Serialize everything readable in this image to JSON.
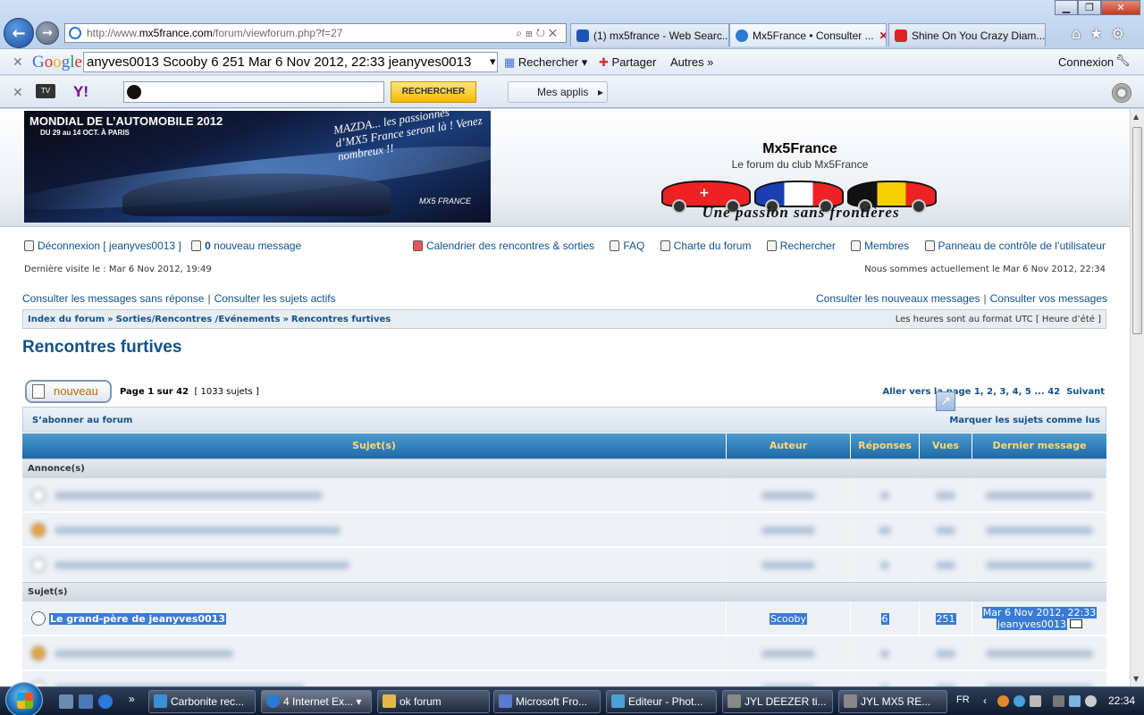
{
  "browser": {
    "address_prefix": "http://www.",
    "address_host": "mx5france.com",
    "address_path": "/forum/viewforum.php?f=27",
    "tabs": [
      {
        "label": "(1) mx5france - Web Searc...",
        "icon_color": "#1a57b5"
      },
      {
        "label": "Mx5France • Consulter ...",
        "icon_color": "#2a7ad8"
      },
      {
        "label": "Shine On You Crazy Diam...",
        "icon_color": "#d22"
      }
    ],
    "window_controls": [
      "minimize",
      "maximize",
      "close"
    ]
  },
  "google_toolbar": {
    "logo": "Google",
    "query": "anyves0013 Scooby 6 251 Mar 6 Nov 2012, 22:33 jeanyves0013",
    "search_label": "Rechercher",
    "share_label": "Partager",
    "more_label": "Autres »",
    "signin_label": "Connexion"
  },
  "yahoo_toolbar": {
    "logo": "Y!",
    "search_button": "RECHERCHER",
    "apps_label": "Mes applis"
  },
  "site": {
    "banner_title": "MONDIAL DE L’AUTOMOBILE 2012",
    "banner_date": "DU 29 au 14 OCT. À PARIS",
    "banner_slogan": "MAZDA... les passionnés d’MX5 France seront là ! Venez nombreux !!",
    "banner_logo": "MX5 FRANCE",
    "title": "Mx5France",
    "description": "Le forum du club Mx5France",
    "slogan": "Une passion sans frontières"
  },
  "nav": {
    "logout": "Déconnexion [ jeanyves0013 ]",
    "messages_count": "0",
    "messages_label": " nouveau message",
    "calendar": "Calendrier des rencontres & sorties",
    "faq": "FAQ",
    "charter": "Charte du forum",
    "search": "Rechercher",
    "members": "Membres",
    "ucp": "Panneau de contrôle de l’utilisateur",
    "last_visit": "Dernière visite le : Mar 6 Nov 2012, 19:49",
    "now": "Nous sommes actuellement le Mar 6 Nov 2012, 22:34",
    "unanswered": "Consulter les messages sans réponse",
    "active": "Consulter les sujets actifs",
    "new_posts": "Consulter les nouveaux messages",
    "your_posts": "Consulter vos messages"
  },
  "breadcrumb": {
    "items": [
      "Index du forum",
      "Sorties/Rencontres /Evénements",
      "Rencontres furtives"
    ],
    "separator": "»",
    "timezone": "Les heures sont au format UTC [ Heure d’été ]"
  },
  "forum": {
    "title": "Rencontres furtives",
    "new_topic_label": "nouveau",
    "page_prefix": "Page ",
    "page_current": "1",
    "page_of": " sur ",
    "page_total": "42",
    "topic_count": "[ 1033 sujets ]",
    "goto_label": "Aller vers la page ",
    "goto_pages": "1, 2, 3, 4, 5 ... 42",
    "next_label": "Suivant",
    "subscribe": "S’abonner au forum",
    "mark_read": "Marquer les sujets comme lus"
  },
  "table": {
    "headers": {
      "subject": "Sujet(s)",
      "author": "Auteur",
      "replies": "Réponses",
      "views": "Vues",
      "last": "Dernier message"
    },
    "announcements_label": "Annonce(s)",
    "topics_label": "Sujet(s)",
    "highlighted_topic": {
      "title": "Le grand-père de jeanyves0013",
      "author": "Scooby",
      "replies": "6",
      "views": "251",
      "last_date": "Mar 6 Nov 2012, 22:33",
      "last_author": "jeanyves0013"
    }
  },
  "taskbar": {
    "buttons": [
      {
        "label": "Carbonite rec...",
        "color": "#3a8fd8"
      },
      {
        "label": "4 Internet Ex...",
        "color": "#2a7ad8"
      },
      {
        "label": "ok forum",
        "color": "#e5b84a"
      },
      {
        "label": "Microsoft Fro...",
        "color": "#5a7bd0"
      },
      {
        "label": "Editeur - Phot...",
        "color": "#4aa0d8"
      },
      {
        "label": "JYL  DEEZER ti...",
        "color": "#888"
      },
      {
        "label": "JYL  MX5  RE...",
        "color": "#888"
      }
    ],
    "language": "FR",
    "clock": "22:34"
  }
}
